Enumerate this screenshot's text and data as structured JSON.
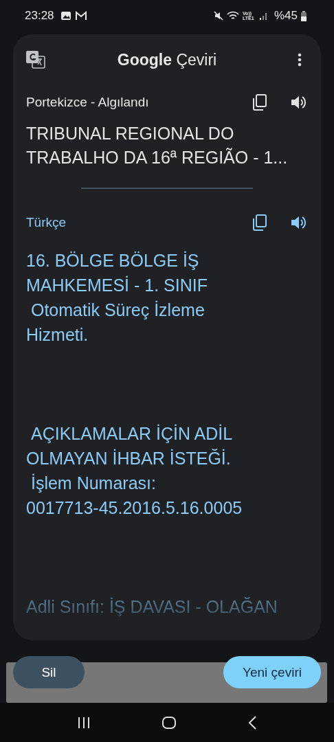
{
  "status_bar": {
    "time": "23:28",
    "battery": "%45",
    "network": "Vo)) LTE1"
  },
  "app_bar": {
    "title_brand": "Google",
    "title_product": "Çeviri"
  },
  "source": {
    "language": "Portekizce - Algılandı",
    "text": "TRIBUNAL REGIONAL DO\nTRABALHO DA 16ª REGIÃO - 1..."
  },
  "target": {
    "language": "Türkçe",
    "text": "16. BÖLGE BÖLGE İŞ\nMAHKEMESİ - 1. SINIF\n Otomatik Süreç İzleme\nHizmeti.\n\n\n\n AÇIKLAMALAR İÇİN ADİL\nOLMAYAN İHBAR İSTEĞİ.\n İşlem Numarası:\n0017713-45.2016.5.16.0005\n\n\n\nAdli Sınıfı: İŞ DAVASI - OLAĞAN"
  },
  "buttons": [
    {
      "label": "Sil",
      "kind": "secondary"
    },
    {
      "label": "Yeni çeviri",
      "kind": "primary"
    }
  ]
}
